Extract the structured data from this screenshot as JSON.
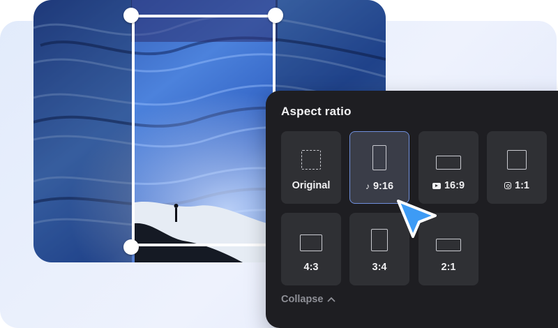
{
  "panel": {
    "title": "Aspect ratio",
    "options": [
      {
        "label": "Original",
        "icon": "dashed-square-icon",
        "selected": false
      },
      {
        "label": "9:16",
        "icon": "tiktok-icon",
        "selected": true
      },
      {
        "label": "16:9",
        "icon": "youtube-icon",
        "selected": false
      },
      {
        "label": "1:1",
        "icon": "instagram-icon",
        "selected": false
      },
      {
        "label": "4:3",
        "icon": "",
        "selected": false
      },
      {
        "label": "3:4",
        "icon": "",
        "selected": false
      },
      {
        "label": "2:1",
        "icon": "",
        "selected": false
      }
    ],
    "collapse_label": "Collapse"
  },
  "colors": {
    "panel_bg": "#1e1e22",
    "tile_bg": "#2f3034",
    "selected_border": "#6f8fdc",
    "cursor": "#3d9bf5"
  }
}
